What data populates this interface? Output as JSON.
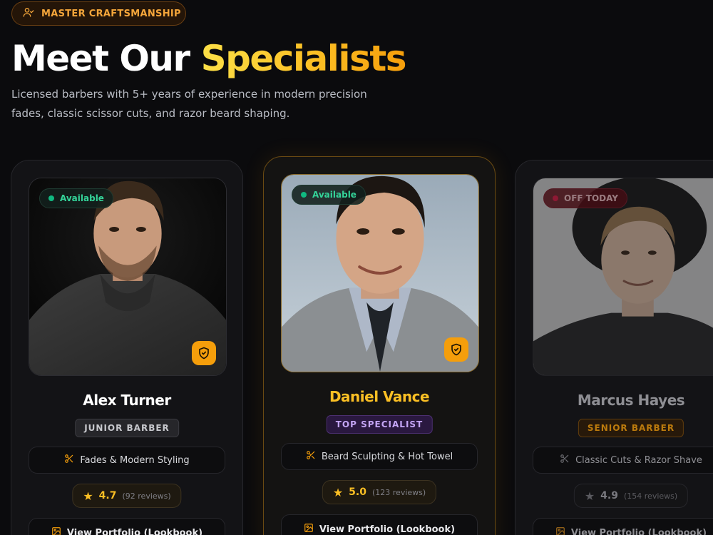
{
  "header": {
    "eyebrow": "MASTER CRAFTSMANSHIP",
    "title_plain": "Meet Our ",
    "title_accent": "Specialists",
    "subtitle": "Licensed barbers with 5+ years of experience in modern precision fades, classic scissor cuts, and razor beard shaping."
  },
  "barbers": [
    {
      "status": "Available",
      "name": "Alex Turner",
      "role": "JUNIOR BARBER",
      "specialty": "Fades & Modern Styling",
      "rating": "4.7",
      "reviews": "(92 reviews)",
      "portfolio_label": "View Portfolio (Lookbook)"
    },
    {
      "status": "Available",
      "name": "Daniel Vance",
      "role": "TOP SPECIALIST",
      "specialty": "Beard Sculpting & Hot Towel",
      "rating": "5.0",
      "reviews": "(123 reviews)",
      "portfolio_label": "View Portfolio (Lookbook)"
    },
    {
      "status": "OFF TODAY",
      "name": "Marcus Hayes",
      "role": "SENIOR BARBER",
      "specialty": "Classic Cuts & Razor Shave",
      "rating": "4.9",
      "reviews": "(154 reviews)",
      "portfolio_label": "View Portfolio (Lookbook)"
    }
  ],
  "colors": {
    "accent": "#f59e0b",
    "available": "#10b981",
    "off": "#e11d48",
    "top_specialist": "#c4a5f5"
  },
  "icons": {
    "eyebrow": "user-check-icon",
    "verified": "shield-check-icon",
    "specialty": "scissors-icon",
    "rating": "star-icon",
    "portfolio": "image-icon"
  }
}
